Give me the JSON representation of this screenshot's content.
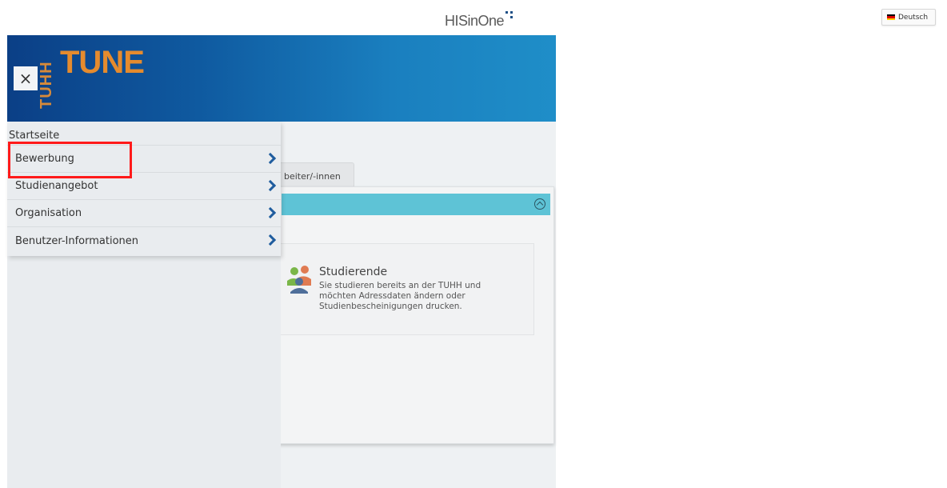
{
  "header": {
    "brand": "HISinOne",
    "language": "Deutsch",
    "app_logo": "TUNE",
    "app_logo_vertical": "TUHH",
    "close_symbol": "×"
  },
  "menu": {
    "items": [
      {
        "label": "Startseite",
        "has_submenu": false
      },
      {
        "label": "Bewerbung",
        "has_submenu": true,
        "highlighted": true
      },
      {
        "label": "Studienangebot",
        "has_submenu": true
      },
      {
        "label": "Organisation",
        "has_submenu": true
      },
      {
        "label": "Benutzer-Informationen",
        "has_submenu": true
      }
    ]
  },
  "content": {
    "tab_label": "beiter/-innen",
    "card": {
      "title": "Studierende",
      "description": "Sie studieren bereits an der TUHH und möchten Adressdaten ändern oder Studienbescheinigungen drucken.",
      "icon": "people-icon"
    }
  },
  "colors": {
    "banner_start": "#0b3f86",
    "banner_end": "#1f8ec8",
    "logo_orange": "#e58b2e",
    "panel_header": "#5ec3d6",
    "chevron": "#1f5c9e",
    "highlight": "#ff1a1a"
  }
}
